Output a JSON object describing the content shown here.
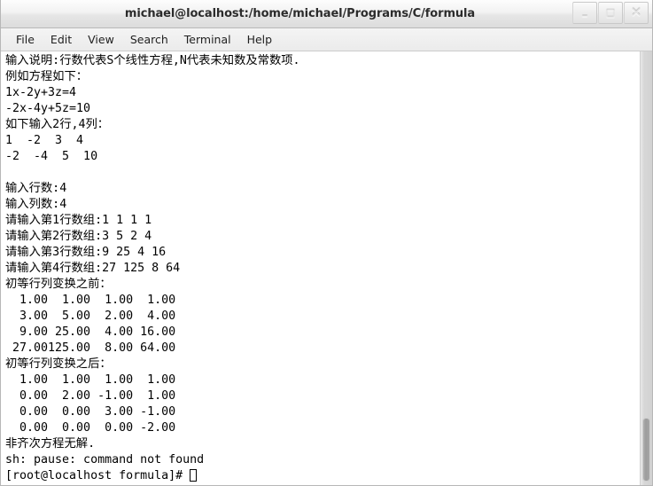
{
  "window": {
    "title": "michael@localhost:/home/michael/Programs/C/formula",
    "controls": [
      {
        "name": "minimize",
        "glyph": "–"
      },
      {
        "name": "maximize",
        "glyph": "□"
      },
      {
        "name": "close",
        "glyph": "✕"
      }
    ]
  },
  "menubar": {
    "items": [
      {
        "label": "File"
      },
      {
        "label": "Edit"
      },
      {
        "label": "View"
      },
      {
        "label": "Search"
      },
      {
        "label": "Terminal"
      },
      {
        "label": "Help"
      }
    ]
  },
  "terminal": {
    "lines": [
      "输入说明:行数代表S个线性方程,N代表未知数及常数项.",
      "例如方程如下：",
      "1x-2y+3z=4",
      "-2x-4y+5z=10",
      "如下输入2行,4列：",
      "1  -2  3  4",
      "-2  -4  5  10",
      "",
      "输入行数:4",
      "输入列数:4",
      "请输入第1行数组:1 1 1 1",
      "请输入第2行数组:3 5 2 4",
      "请输入第3行数组:9 25 4 16",
      "请输入第4行数组:27 125 8 64",
      "初等行列变换之前：",
      "  1.00  1.00  1.00  1.00",
      "  3.00  5.00  2.00  4.00",
      "  9.00 25.00  4.00 16.00",
      " 27.00125.00  8.00 64.00",
      "初等行列变换之后：",
      "  1.00  1.00  1.00  1.00",
      "  0.00  2.00 -1.00  1.00",
      "  0.00  0.00  3.00 -1.00",
      "  0.00  0.00  0.00 -2.00",
      "非齐次方程无解.",
      "sh: pause: command not found"
    ],
    "prompt": "[root@localhost formula]# ",
    "cursor_visible": true,
    "foreground_color": "#000000",
    "background_color": "#ffffff"
  },
  "scrollbar": {
    "thumb_position": "bottom"
  }
}
